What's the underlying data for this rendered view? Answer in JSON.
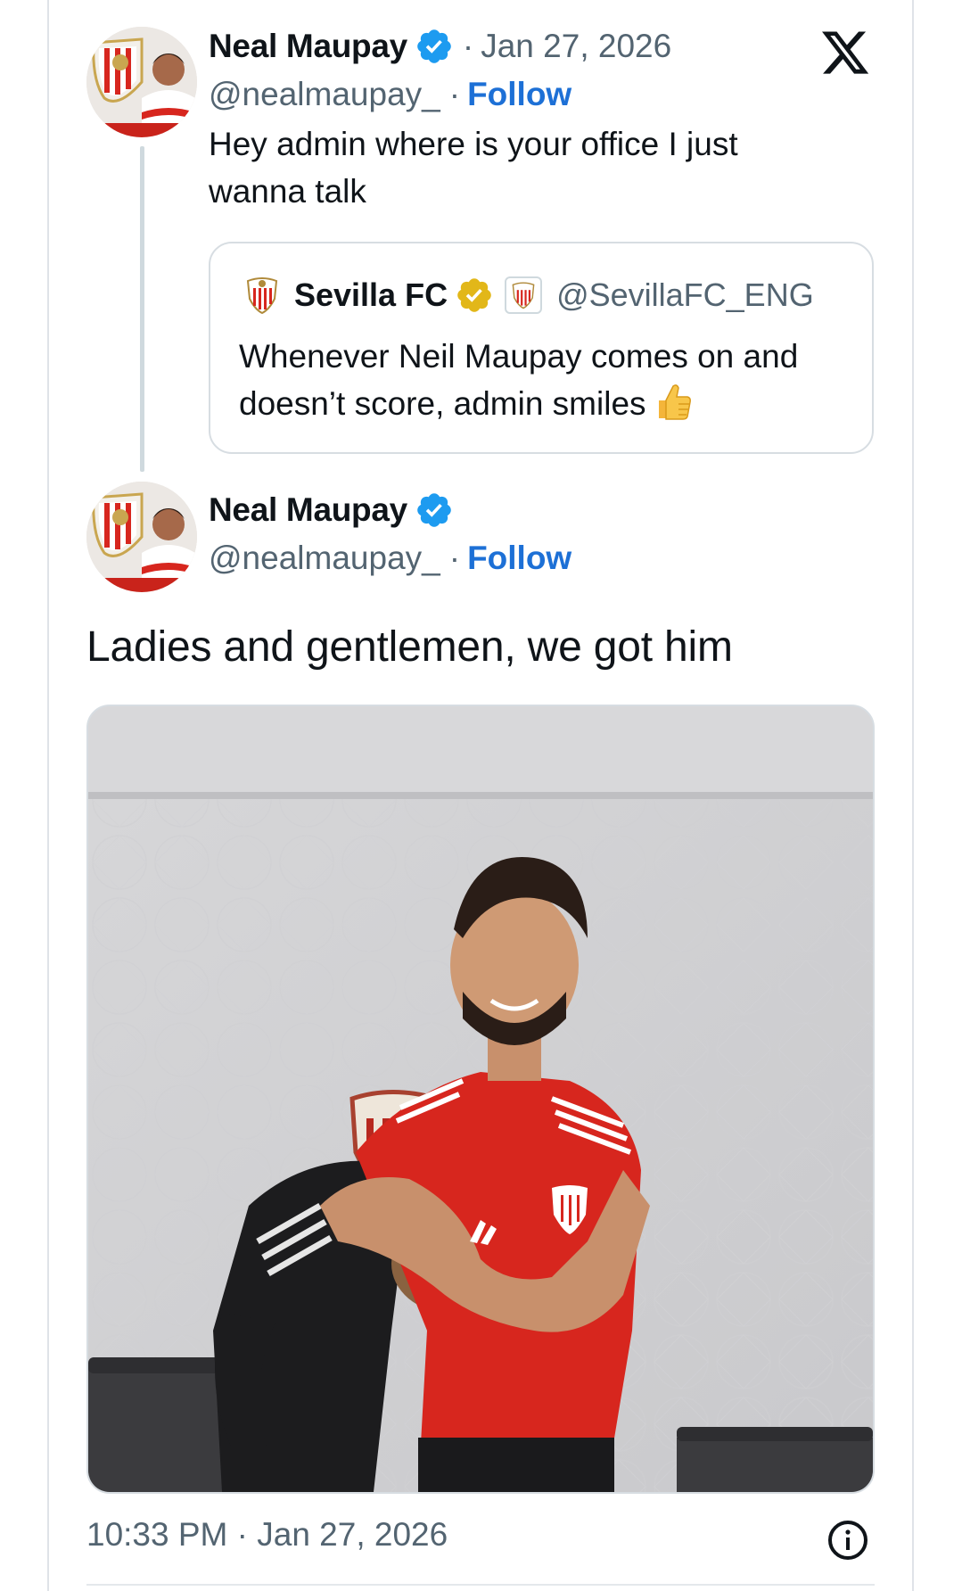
{
  "tweet_parent": {
    "author_name": "Neal Maupay",
    "handle": "@nealmaupay_",
    "date_prefix": "·",
    "date": "Jan 27, 2026",
    "separator": "·",
    "follow_label": "Follow",
    "text": "Hey admin where is your office I just wanna talk"
  },
  "quoted_tweet": {
    "author_name": "Sevilla FC",
    "handle": "@SevillaFC_ENG",
    "text": "Whenever Neil Maupay comes on and doesn’t score, admin smiles"
  },
  "tweet_main": {
    "author_name": "Neal Maupay",
    "handle": "@nealmaupay_",
    "separator": "·",
    "follow_label": "Follow",
    "text": "Ladies and gentlemen, we got him",
    "timestamp": "10:33 PM · Jan 27, 2026"
  },
  "colors": {
    "verified_blue": "#1d9bf0",
    "verified_gold": "#e2b719",
    "link_blue": "#1d70d6",
    "jersey_red": "#d7261e"
  },
  "icons": {
    "logo": "x-logo-icon",
    "verified": "verified-badge-icon",
    "info": "info-icon",
    "emoji": "thumbs-up-emoji"
  }
}
